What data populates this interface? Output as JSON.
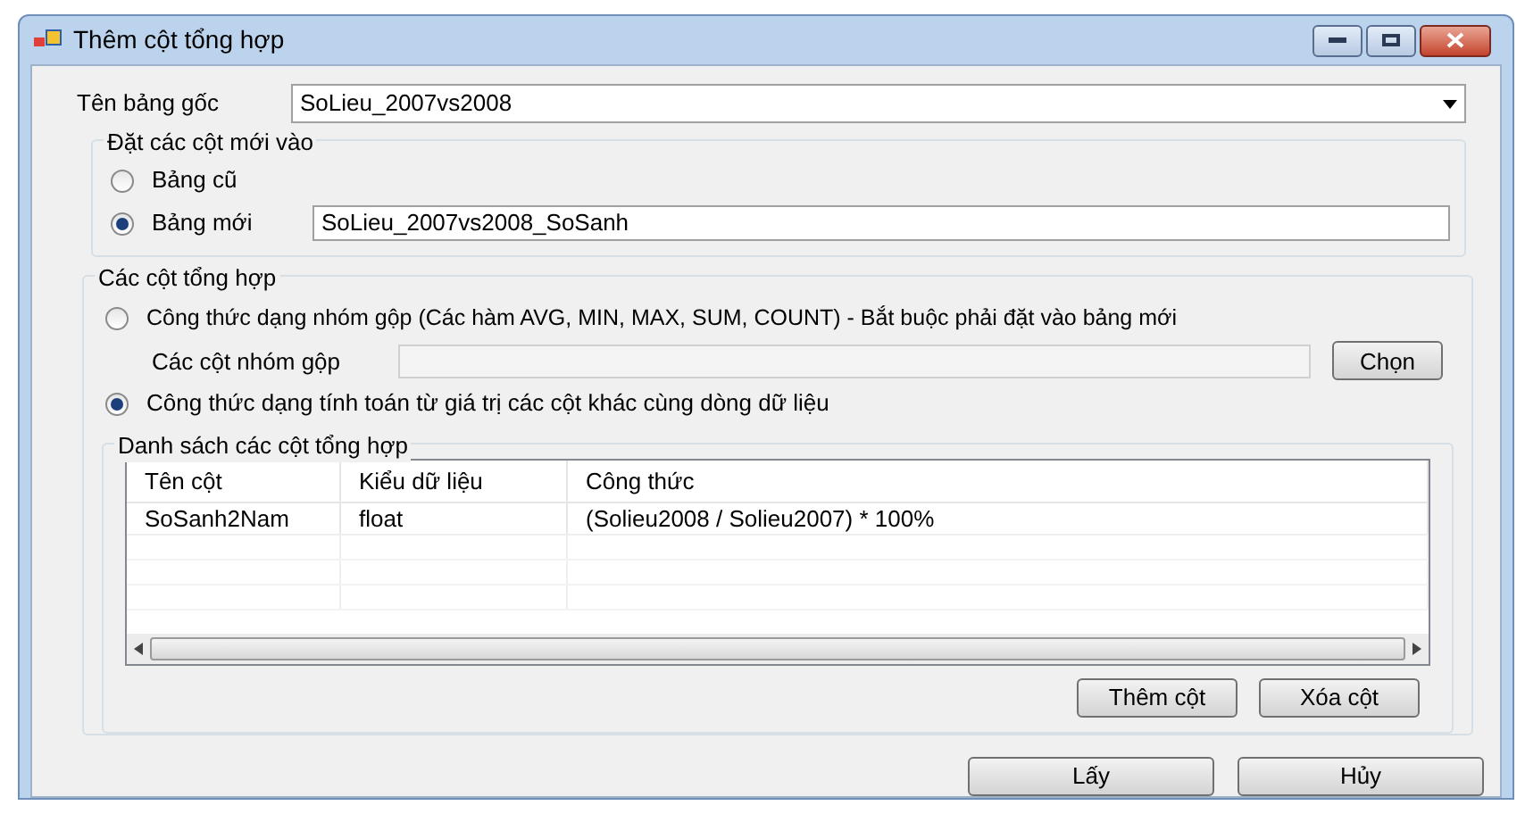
{
  "window": {
    "title": "Thêm cột tổng hợp"
  },
  "source_table": {
    "label": "Tên bảng gốc",
    "value": "SoLieu_2007vs2008"
  },
  "placement": {
    "title": "Đặt các cột mới vào",
    "options": [
      {
        "label": "Bảng cũ",
        "selected": false
      },
      {
        "label": "Bảng mới",
        "selected": true,
        "value": "SoLieu_2007vs2008_SoSanh"
      }
    ]
  },
  "aggregate": {
    "title": "Các cột tổng hợp",
    "group_option": {
      "label": "Công thức dạng nhóm gộp (Các hàm AVG, MIN, MAX, SUM, COUNT) - Bắt buộc phải đặt vào bảng mới",
      "selected": false
    },
    "group_columns": {
      "label": "Các cột nhóm gộp",
      "button": "Chọn"
    },
    "row_option": {
      "label": "Công thức dạng tính toán từ giá trị các cột khác cùng dòng dữ liệu",
      "selected": true
    },
    "list": {
      "title": "Danh sách các cột tổng hợp",
      "table": {
        "columns": [
          "Tên cột",
          "Kiểu dữ liệu",
          "Công thức"
        ],
        "rows": [
          [
            "SoSanh2Nam",
            "float",
            "(Solieu2008 / Solieu2007) * 100%"
          ]
        ]
      },
      "buttons": [
        "Thêm cột",
        "Xóa cột"
      ]
    }
  },
  "buttons": [
    "Lấy",
    "Hủy"
  ]
}
